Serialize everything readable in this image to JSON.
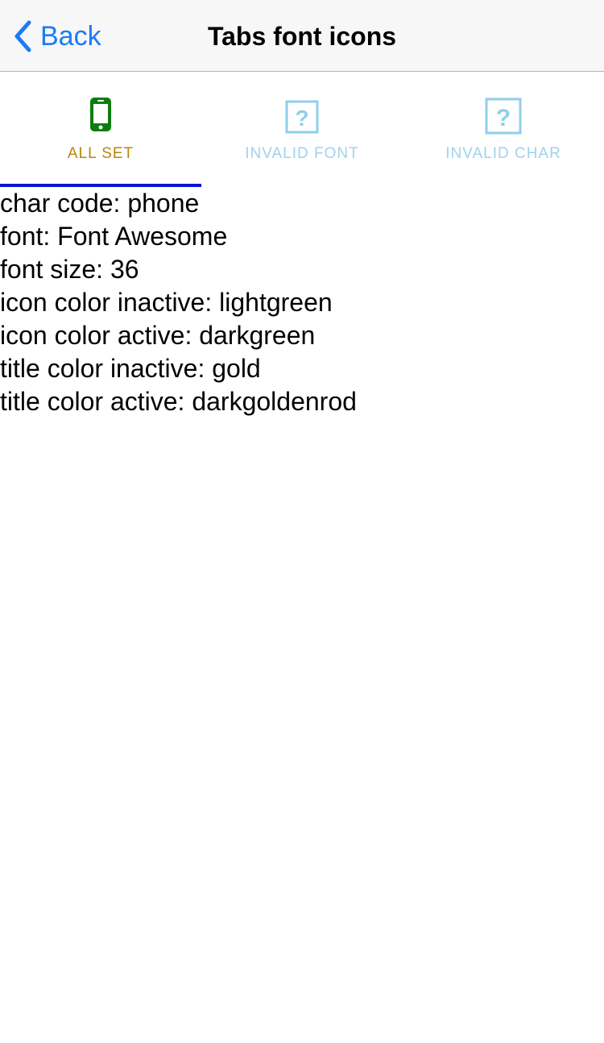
{
  "nav": {
    "back_label": "Back",
    "title": "Tabs font icons"
  },
  "tabs": [
    {
      "label": "ALL SET",
      "icon": "phone-icon",
      "active": true,
      "color": "#b8860b",
      "icon_color": "#0e7d0e"
    },
    {
      "label": "INVALID FONT",
      "icon": "question-box-icon",
      "active": false,
      "color": "#9fd3ec",
      "icon_color": "#8fcfea"
    },
    {
      "label": "INVALID CHAR",
      "icon": "question-box-icon",
      "active": false,
      "color": "#9fd3ec",
      "icon_color": "#8fcfea"
    }
  ],
  "colors": {
    "accent": "#1a7cf5",
    "tab_indicator": "#0a14d4"
  },
  "details": [
    "char code: phone",
    "font: Font Awesome",
    "font size: 36",
    "icon color inactive: lightgreen",
    "icon color active: darkgreen",
    "title color inactive: gold",
    "title color active: darkgoldenrod"
  ]
}
